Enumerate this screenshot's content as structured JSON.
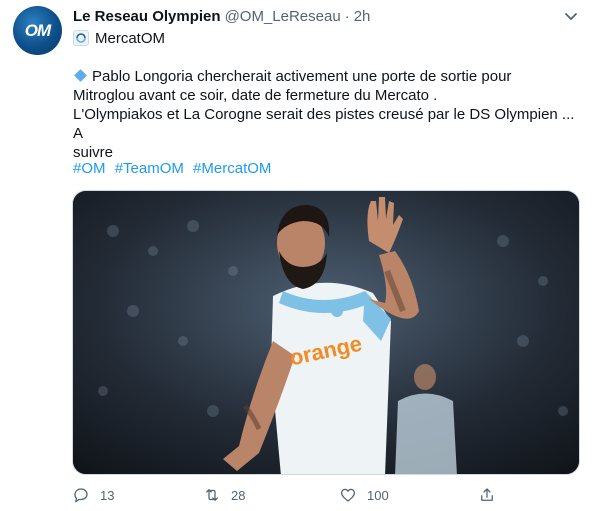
{
  "tweet": {
    "author_name": "Le Reseau Olympien",
    "author_handle": "@OM_LeReseau",
    "separator": "·",
    "time": "2h",
    "avatar_text": "OM",
    "context_tag": "MercatOM",
    "body_lines": [
      "Pablo Longoria chercherait activement une porte de sortie pour",
      "Mitroglou avant ce soir, date de fermeture du Mercato .",
      "L'Olympiakos et La Corogne serait des pistes creusé par le DS Olympien ... A",
      "suivre"
    ],
    "hashtags": [
      "#OM",
      "#TeamOM",
      "#MercatOM"
    ],
    "media_text": "orange",
    "actions": {
      "reply_count": "13",
      "retweet_count": "28",
      "like_count": "100"
    }
  },
  "colors": {
    "link": "#1d9bf0",
    "muted": "#536471",
    "text": "#0f1419"
  },
  "icons": [
    "chevron-down-icon",
    "reply-icon",
    "retweet-icon",
    "like-icon",
    "share-icon",
    "diamond-icon"
  ]
}
